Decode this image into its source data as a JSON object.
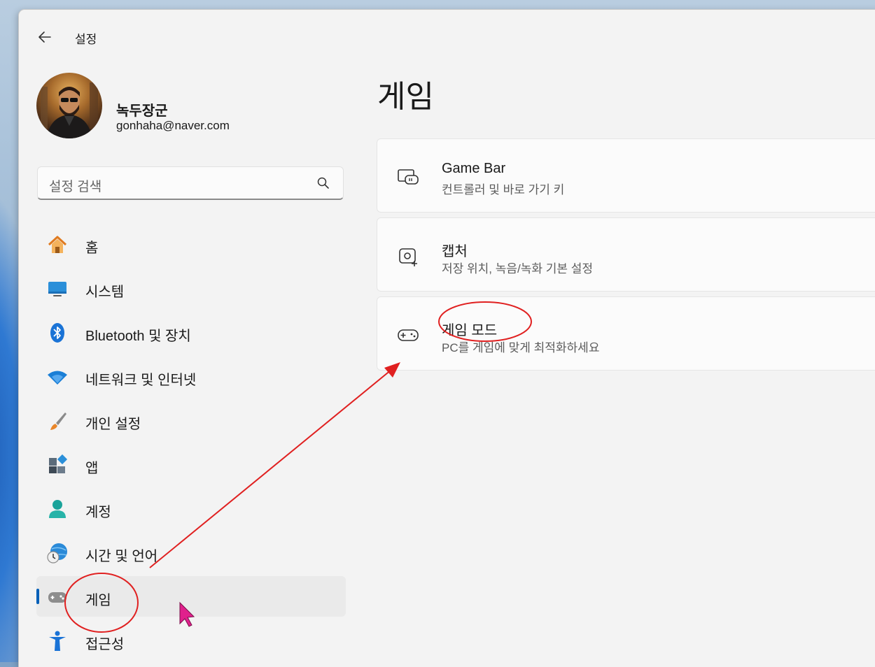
{
  "window": {
    "title": "설정"
  },
  "profile": {
    "name": "녹두장군",
    "email": "gonhaha@naver.com"
  },
  "search": {
    "placeholder": "설정 검색"
  },
  "nav": {
    "items": [
      {
        "label": "홈",
        "icon": "home-icon"
      },
      {
        "label": "시스템",
        "icon": "system-icon"
      },
      {
        "label": "Bluetooth 및 장치",
        "icon": "bluetooth-icon"
      },
      {
        "label": "네트워크 및 인터넷",
        "icon": "wifi-icon"
      },
      {
        "label": "개인 설정",
        "icon": "brush-icon"
      },
      {
        "label": "앱",
        "icon": "apps-icon"
      },
      {
        "label": "계정",
        "icon": "account-icon"
      },
      {
        "label": "시간 및 언어",
        "icon": "globe-clock-icon"
      },
      {
        "label": "게임",
        "icon": "gamepad-icon",
        "selected": true
      },
      {
        "label": "접근성",
        "icon": "accessibility-icon"
      }
    ]
  },
  "main": {
    "title": "게임",
    "cards": [
      {
        "title": "Game Bar",
        "desc": "컨트롤러 및 바로 가기 키",
        "icon": "game-bar-icon"
      },
      {
        "title": "캡처",
        "desc": "저장 위치, 녹음/녹화 기본 설정",
        "icon": "capture-icon"
      },
      {
        "title": "게임 모드",
        "desc": "PC를 게임에 맞게 최적화하세요",
        "icon": "game-mode-icon"
      }
    ]
  },
  "colors": {
    "accent": "#005fb8",
    "annotation": "#e02020",
    "cursor": "#e0208c"
  }
}
